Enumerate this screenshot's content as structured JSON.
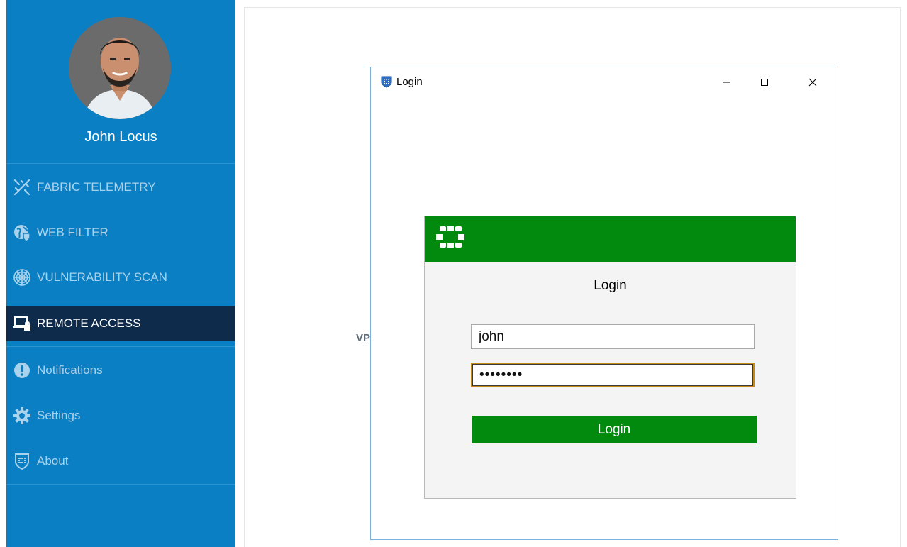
{
  "profile": {
    "name": "John Locus"
  },
  "sidebar": {
    "items": [
      {
        "label": "FABRIC TELEMETRY",
        "icon": "fabric-telemetry-icon"
      },
      {
        "label": "WEB FILTER",
        "icon": "globe-shield-icon"
      },
      {
        "label": "VULNERABILITY SCAN",
        "icon": "radar-icon"
      },
      {
        "label": "REMOTE ACCESS",
        "icon": "laptop-lock-icon",
        "active": true
      },
      {
        "label": "Notifications",
        "icon": "exclamation-icon"
      },
      {
        "label": "Settings",
        "icon": "gear-icon"
      },
      {
        "label": "About",
        "icon": "shield-logo-icon"
      }
    ]
  },
  "main": {
    "partial_text": "VP"
  },
  "login_window": {
    "title": "Login",
    "dialog": {
      "heading": "Login",
      "username_value": "john",
      "password_value": "••••••••",
      "submit_label": "Login"
    }
  },
  "colors": {
    "sidebar_bg": "#0b7fc3",
    "active_item_bg": "#0e2b4b",
    "brand_green": "#028a0f",
    "focus_border": "#c58a16"
  }
}
